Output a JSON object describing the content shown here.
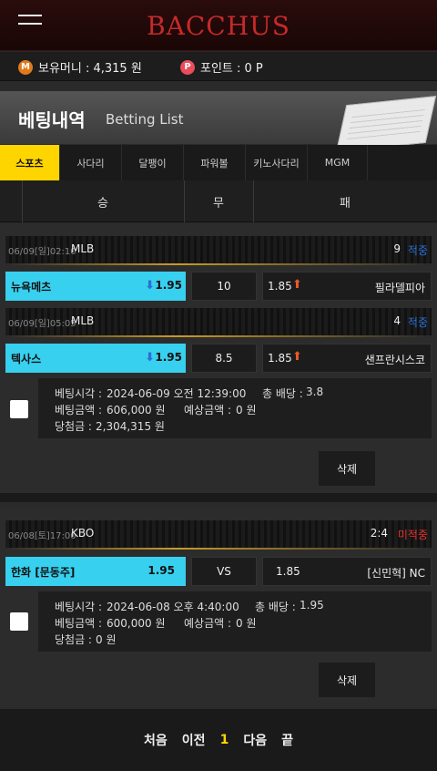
{
  "app": {
    "logo": "BACCHUS"
  },
  "account": {
    "money_label": "보유머니 : 4,315 원",
    "points_label": "포인트 : 0 P",
    "money_icon": "M",
    "points_icon": "P"
  },
  "header": {
    "title": "베팅내역",
    "subtitle": "Betting List"
  },
  "tabs": [
    "스포츠",
    "사다리",
    "달팽이",
    "파워볼",
    "키노사다리",
    "MGM"
  ],
  "columns": {
    "win": "승",
    "draw": "무",
    "lose": "패"
  },
  "bets": [
    {
      "games": [
        {
          "date": "06/09[일]02:10",
          "league": "MLB",
          "score": "9",
          "result": "적중",
          "home": "뉴욕메츠",
          "home_odds": "1.95",
          "mid": "10",
          "away_odds": "1.85",
          "away": "필라델피아"
        },
        {
          "date": "06/09[일]05:05",
          "league": "MLB",
          "score": "4",
          "result": "적중",
          "home": "텍사스",
          "home_odds": "1.95",
          "mid": "8.5",
          "away_odds": "1.85",
          "away": "샌프란시스코"
        }
      ],
      "bet_time_label": "베팅시각 :",
      "bet_time": "2024-06-09 오전 12:39:00",
      "total_odds_label": "총 배당 :",
      "total_odds": "3.8",
      "amount_label": "베팅금액 :",
      "amount": "606,000 원",
      "expected_label": "예상금액 :",
      "expected": "0 원",
      "win_label": "당첨금 :",
      "win": "2,304,315 원",
      "delete": "삭제"
    },
    {
      "games": [
        {
          "date": "06/08[토]17:00",
          "league": "KBO",
          "score": "2:4",
          "result": "미적중",
          "home": "한화 [문동주]",
          "home_odds": "1.95",
          "mid": "VS",
          "away_odds": "1.85",
          "away": "[신민혁] NC"
        }
      ],
      "bet_time_label": "베팅시각 :",
      "bet_time": "2024-06-08 오후 4:40:00",
      "total_odds_label": "총 배당 :",
      "total_odds": "1.95",
      "amount_label": "베팅금액 :",
      "amount": "600,000 원",
      "expected_label": "예상금액 :",
      "expected": "0 원",
      "win_label": "당첨금 :",
      "win": "0 원",
      "delete": "삭제"
    }
  ],
  "pager": {
    "first": "처음",
    "prev": "이전",
    "current": "1",
    "next": "다음",
    "last": "끝"
  },
  "colors": {
    "accent_yellow": "#ffd500",
    "home_cyan": "#38d0ef",
    "hit_blue": "#2a6fd6",
    "miss_red": "#e83030",
    "amount_orange": "#f0a03a"
  }
}
